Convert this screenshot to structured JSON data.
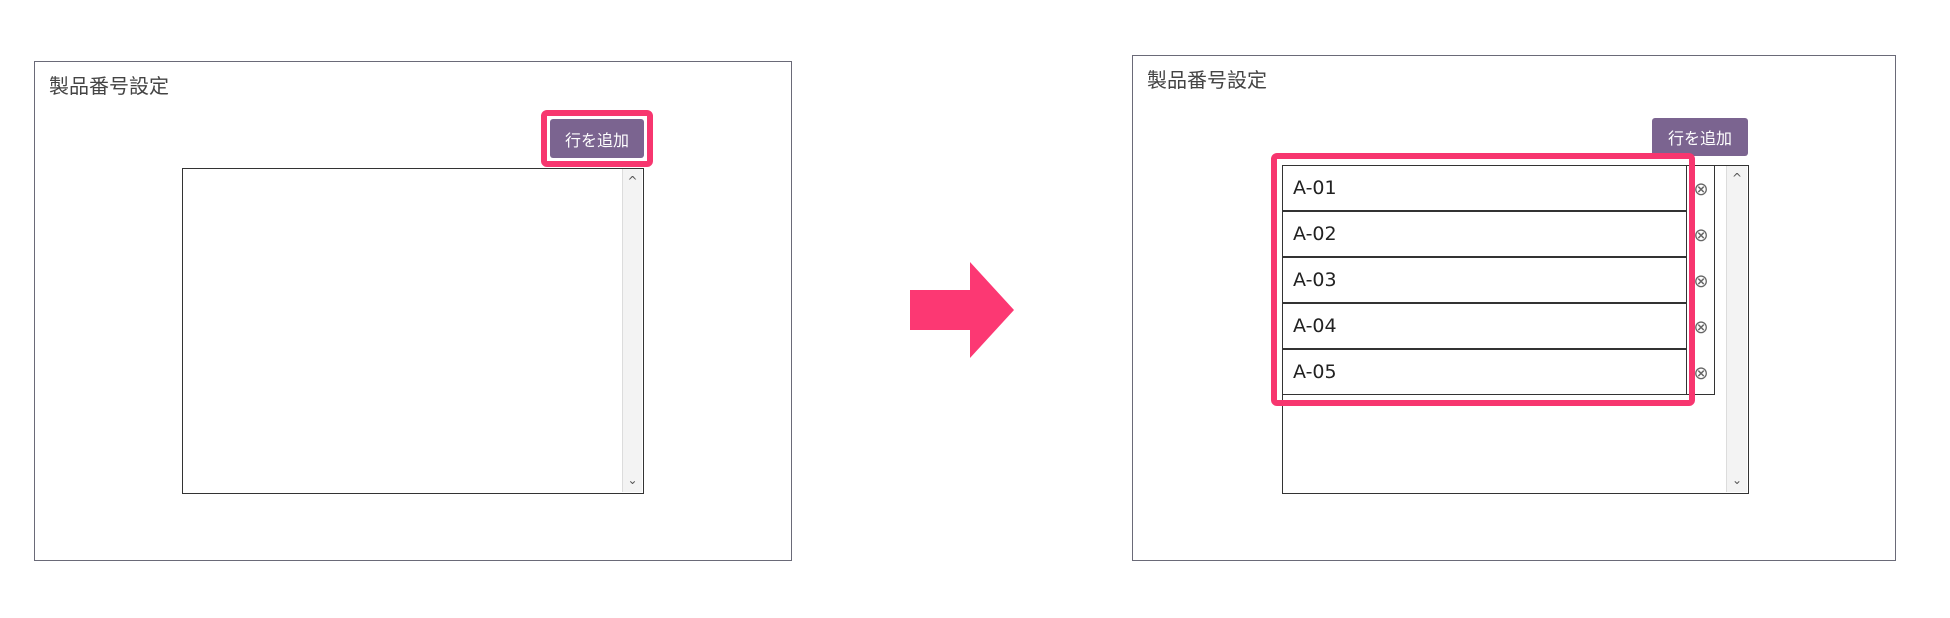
{
  "before": {
    "title": "製品番号設定",
    "add_row_label": "行を追加",
    "scroll_up": "^",
    "scroll_down": "⌄"
  },
  "after": {
    "title": "製品番号設定",
    "add_row_label": "行を追加",
    "rows": [
      "A-01",
      "A-02",
      "A-03",
      "A-04",
      "A-05"
    ],
    "remove_icon": "⊗",
    "scroll_up": "^",
    "scroll_down": "⌄"
  },
  "colors": {
    "highlight": "#f7366f",
    "button": "#7b6490",
    "arrow": "#fc3873"
  }
}
